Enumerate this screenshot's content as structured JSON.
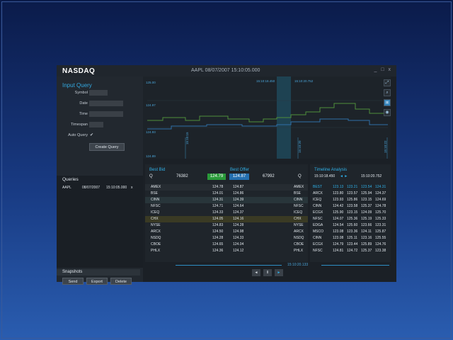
{
  "app": {
    "logo": "NASDAQ",
    "title": "AAPL 08/07/2007 15:10:05.000",
    "window_controls": "_ □ x"
  },
  "input_query": {
    "heading": "Input Query",
    "symbol_label": "Symbol",
    "date_label": "Date",
    "time_label": "Time",
    "timespan_label": "Timespan",
    "auto_query_label": "Auto Query",
    "auto_query_check": "✔",
    "create_button": "Create Query"
  },
  "queries": {
    "heading": "Queries",
    "rows": [
      {
        "symbol": "AAPL",
        "date": "08/07/2007",
        "time": "15:10:05.000",
        "close": "x"
      }
    ]
  },
  "snapshots": {
    "heading": "Snapshots",
    "send": "Send",
    "export": "Export",
    "delete": "Delete"
  },
  "chart": {
    "y_ticks": [
      "125.00",
      "124.97",
      "124.93",
      "124.89"
    ],
    "range_start": "15:10:18.450",
    "range_end": "15:10:20.752",
    "x_markers": [
      "15:10:15",
      "15:10:20",
      "15:10:22"
    ]
  },
  "best_bid": {
    "heading": "Best Bid",
    "side": "Q",
    "size": "76382",
    "price": "124.79",
    "rows": [
      {
        "ex": "AMEX",
        "px": "124.78"
      },
      {
        "ex": "BSE",
        "px": "124.01"
      },
      {
        "ex": "CINN",
        "px": "124.31"
      },
      {
        "ex": "NFSC",
        "px": "124.71"
      },
      {
        "ex": "ICEQ",
        "px": "124.33"
      },
      {
        "ex": "CHX",
        "px": "124.05"
      },
      {
        "ex": "NYSE",
        "px": "124.83"
      },
      {
        "ex": "ARCX",
        "px": "124.50"
      },
      {
        "ex": "NSDQ",
        "px": "124.28"
      },
      {
        "ex": "CBOE",
        "px": "124.65"
      },
      {
        "ex": "PHLX",
        "px": "124.36"
      }
    ]
  },
  "best_offer": {
    "heading": "Best Offer",
    "price": "124.87",
    "size": "67992",
    "side": "Q",
    "rows": [
      {
        "px": "124.87",
        "ex": "AMEX"
      },
      {
        "px": "124.86",
        "ex": "BSE"
      },
      {
        "px": "124.39",
        "ex": "CINN"
      },
      {
        "px": "124.64",
        "ex": "NFSC"
      },
      {
        "px": "124.37",
        "ex": "ICEQ"
      },
      {
        "px": "124.16",
        "ex": "CHX"
      },
      {
        "px": "124.28",
        "ex": "NYSE"
      },
      {
        "px": "124.98",
        "ex": "ARCX"
      },
      {
        "px": "124.33",
        "ex": "NSDQ"
      },
      {
        "px": "124.04",
        "ex": "CBOE"
      },
      {
        "px": "124.12",
        "ex": "PHLX"
      }
    ]
  },
  "timeline": {
    "heading": "Timeline Analysis",
    "start": "15:10:18.450",
    "arrows": "◄ ►",
    "end": "15:10:20.752",
    "columns": [
      "BEST",
      "123.13",
      "123.21",
      "123.54",
      "124.31"
    ],
    "rows": [
      [
        "ARCX",
        "123.80",
        "123.57",
        "125.94",
        "124.37"
      ],
      [
        "ICEQ",
        "123.93",
        "125.86",
        "123.15",
        "124.69"
      ],
      [
        "CINN",
        "124.42",
        "123.58",
        "125.37",
        "124.78"
      ],
      [
        "ECGX",
        "125.90",
        "123.15",
        "124.09",
        "125.70"
      ],
      [
        "NFSC",
        "124.07",
        "125.36",
        "125.19",
        "125.33"
      ],
      [
        "EDGA",
        "124.54",
        "125.60",
        "123.66",
        "123.31"
      ],
      [
        "MSCO",
        "123.08",
        "123.36",
        "124.11",
        "125.87"
      ],
      [
        "CINN",
        "123.08",
        "125.11",
        "123.16",
        "125.55"
      ],
      [
        "ECGX",
        "124.79",
        "123.44",
        "125.89",
        "124.76"
      ],
      [
        "NFSC",
        "124.81",
        "124.72",
        "125.37",
        "123.38"
      ]
    ]
  },
  "footer": {
    "timestamp": "15:10:20.133",
    "prev": "◄",
    "pause": "II",
    "next": "►"
  }
}
